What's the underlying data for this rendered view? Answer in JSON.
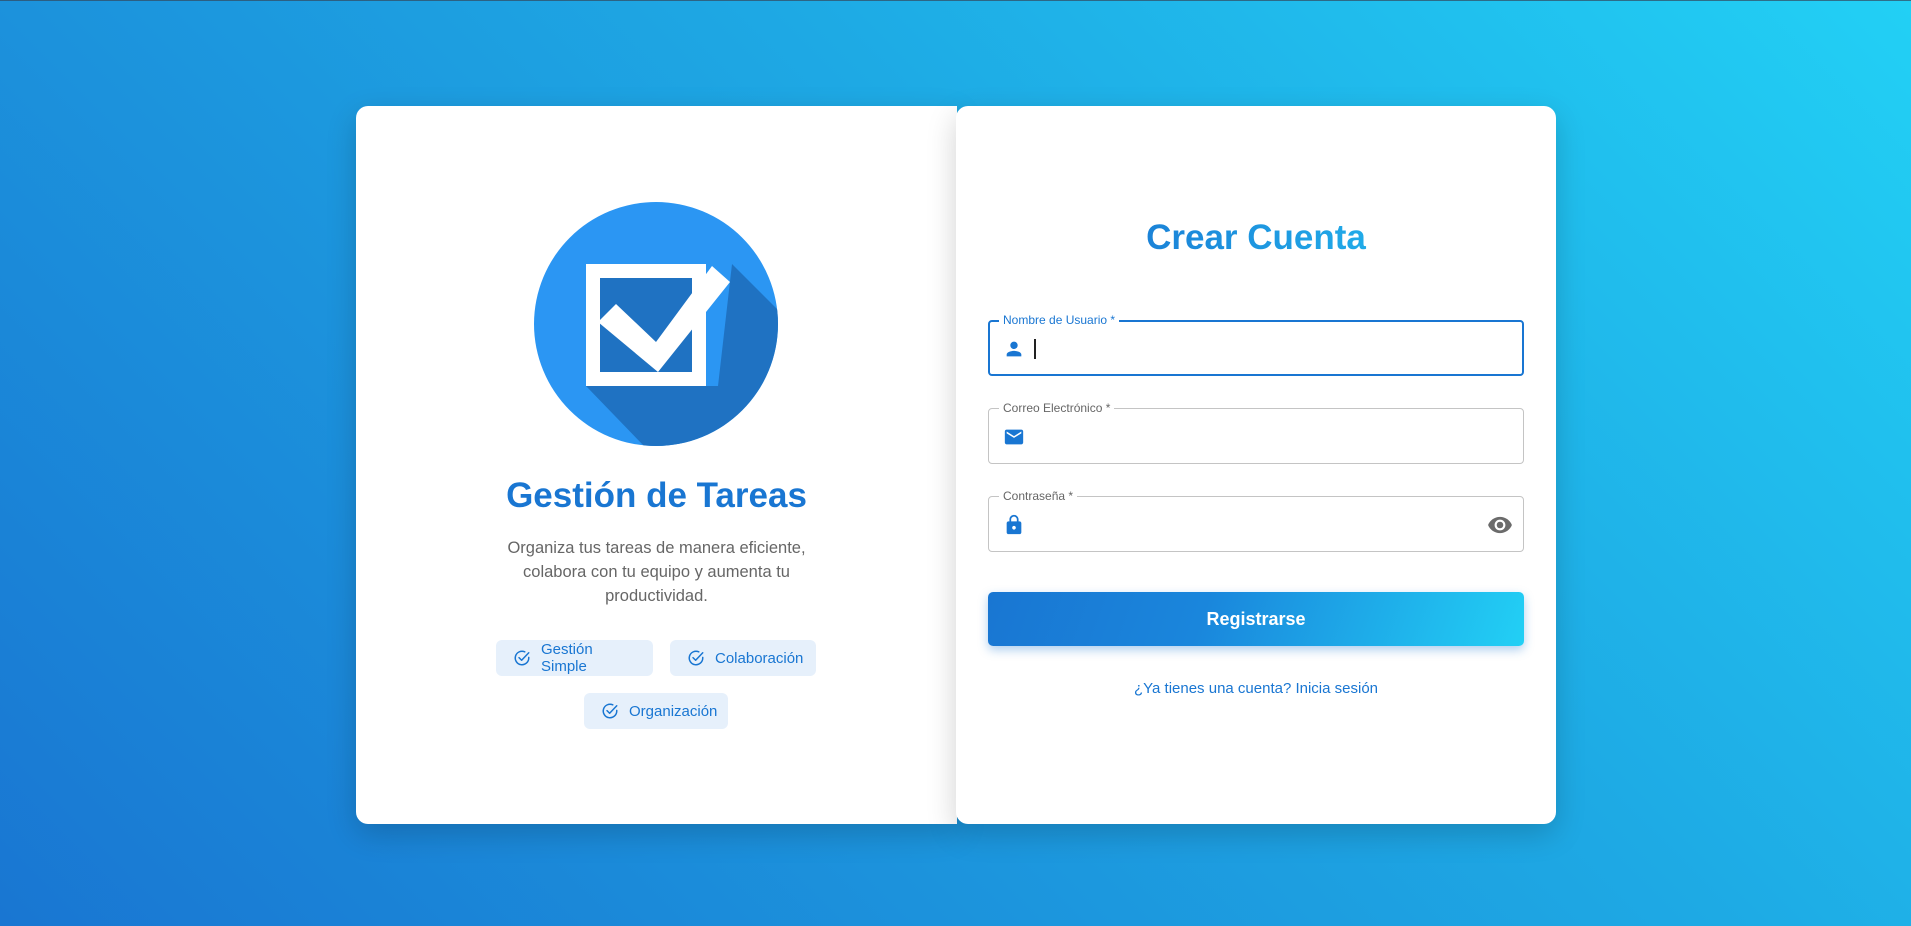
{
  "colors": {
    "primary": "#1976d2",
    "accent": "#22d0f5",
    "chip_bg": "#e6f0fb"
  },
  "intro": {
    "title": "Gestión de Tareas",
    "description": "Organiza tus tareas de manera eficiente, colabora con tu equipo y aumenta tu productividad.",
    "logo_icon": "checkbox-logo-icon",
    "features": [
      {
        "label": "Gestión Simple",
        "icon": "check-circle-icon"
      },
      {
        "label": "Colaboración",
        "icon": "check-circle-icon"
      },
      {
        "label": "Organización",
        "icon": "check-circle-icon"
      }
    ]
  },
  "form": {
    "title": "Crear Cuenta",
    "fields": [
      {
        "label": "Nombre de Usuario *",
        "value": "",
        "icon": "person-icon",
        "focused": true
      },
      {
        "label": "Correo Electrónico *",
        "value": "",
        "icon": "mail-icon"
      },
      {
        "label": "Contraseña *",
        "value": "",
        "icon": "lock-icon",
        "trailing_icon": "eye-icon"
      }
    ],
    "submit_label": "Registrarse",
    "login_link": "¿Ya tienes una cuenta? Inicia sesión"
  }
}
